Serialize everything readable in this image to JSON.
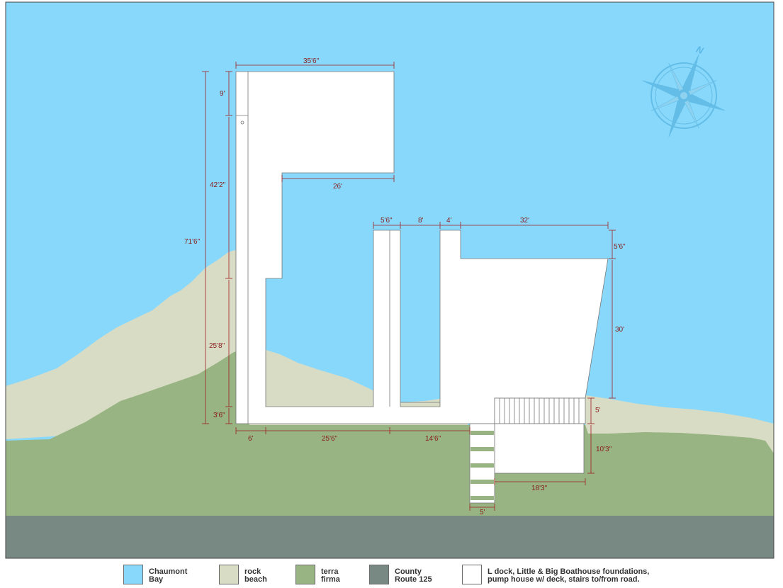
{
  "colors": {
    "bay": "#88d8fc",
    "beach": "#d9dcc5",
    "terra": "#97b482",
    "road": "#778982",
    "structure": "#ffffff",
    "dimension": "#a11f1f",
    "compass": "#63bde6"
  },
  "compass": {
    "north_label": "N"
  },
  "dimensions": {
    "d_35_6": "35'6\"",
    "d_9": "9'",
    "d_42_2": "42'2\"",
    "d_71_6": "71'6\"",
    "d_26": "26'",
    "d_25_8": "25'8\"",
    "d_3_6": "3'6\"",
    "d_6": "6'",
    "d_25_6": "25'6\"",
    "d_14_6": "14'6\"",
    "d_5_6_top": "5'6\"",
    "d_8": "8'",
    "d_4": "4'",
    "d_32": "32'",
    "d_5_6_right": "5'6\"",
    "d_30": "30'",
    "d_5": "5'",
    "d_10_3": "10'3\"",
    "d_18_3": "18'3\"",
    "d_5_stairs": "5'"
  },
  "legend": [
    {
      "color": "#88d8fc",
      "line1": "Chaumont",
      "line2": "Bay"
    },
    {
      "color": "#d9dcc5",
      "line1": "rock",
      "line2": "beach"
    },
    {
      "color": "#97b482",
      "line1": "terra",
      "line2": "firma"
    },
    {
      "color": "#778982",
      "line1": "County",
      "line2": "Route 125"
    },
    {
      "color": "#ffffff",
      "line1": "L dock, Little & Big Boathouse foundations,",
      "line2": "pump house w/ deck, stairs to/from road."
    }
  ]
}
